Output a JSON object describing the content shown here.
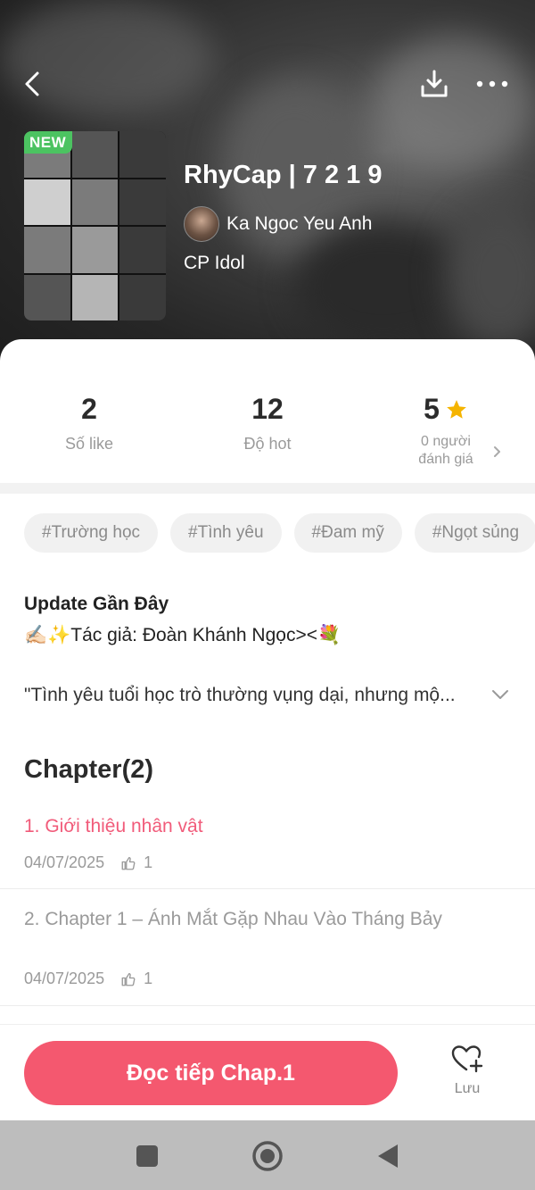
{
  "story": {
    "title": "RhyCap | 7 2 1 9",
    "badge": "NEW",
    "author": "Ka Ngoc Yeu Anh",
    "category": "CP Idol"
  },
  "stats": {
    "likes": {
      "value": "2",
      "label": "Số like"
    },
    "hot": {
      "value": "12",
      "label": "Độ hot"
    },
    "rating": {
      "value": "5",
      "label_line1": "0 người",
      "label_line2": "đánh giá"
    }
  },
  "tags": [
    "#Trường học",
    "#Tình yêu",
    "#Đam mỹ",
    "#Ngọt sủng"
  ],
  "update": {
    "title": "Update Gần Đây",
    "author_line": "✍🏻✨Tác giả: Đoàn Khánh Ngọc><💐",
    "description": "\"Tình yêu tuổi học trò thường vụng dại, nhưng mộ..."
  },
  "chapters": {
    "heading": "Chapter(2)",
    "items": [
      {
        "name": "1. Giới thiệu nhân vật",
        "date": "04/07/2025",
        "likes": "1"
      },
      {
        "name": "2. Chapter 1 – Ánh Mắt Gặp Nhau Vào Tháng Bảy",
        "date": "04/07/2025",
        "likes": "1"
      }
    ]
  },
  "actions": {
    "read": "Đọc tiếp Chap.1",
    "save": "Lưu"
  },
  "icons": {
    "back": "chevron-left-icon",
    "download": "download-icon",
    "more": "more-horizontal-icon",
    "star": "star-icon",
    "thumb": "thumbs-up-icon",
    "heart": "heart-plus-icon"
  },
  "colors": {
    "accent": "#f4586f",
    "active_chapter": "#f15b7a",
    "new_badge": "#4cc361",
    "star": "#f5b400"
  }
}
